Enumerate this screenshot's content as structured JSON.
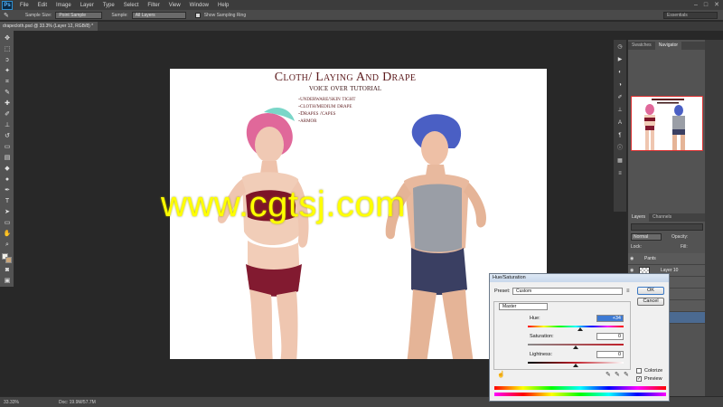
{
  "menubar": {
    "logo": "Ps",
    "items": [
      "File",
      "Edit",
      "Image",
      "Layer",
      "Type",
      "Select",
      "Filter",
      "View",
      "Window",
      "Help"
    ],
    "window_controls": [
      "‒",
      "□",
      "✕"
    ]
  },
  "options": {
    "sample_size_label": "Sample Size:",
    "sample_size_value": "Point Sample",
    "sample_label": "Sample:",
    "sample_value": "All Layers",
    "show_ring_label": "Show Sampling Ring",
    "workspace": "Essentials"
  },
  "document": {
    "tab_title": "drapecloth.psd @ 33.3% (Layer 12, RGB/8) *"
  },
  "artwork": {
    "title": "Cloth/ Laying And Drape",
    "subtitle": "voice over tutorial",
    "bullets": [
      "-underware/skin tight",
      "-cloth/medium drape",
      "-Drapes /capes",
      "-armor"
    ],
    "watermark": "www.cgtsj.com"
  },
  "panels": {
    "top_tabs": [
      "Swatches",
      "Navigator"
    ],
    "layer_tabs": [
      "Layers",
      "Channels"
    ],
    "blend_mode": "Normal",
    "opacity_label": "Opacity:",
    "fill_label": "Fill:",
    "lock_label": "Lock:",
    "layers": [
      "Pants",
      "Layer 10"
    ]
  },
  "status": {
    "zoom": "33.33%",
    "doc": "Doc: 19.9M/57.7M"
  },
  "hue_sat": {
    "title": "Hue/Saturation",
    "preset_label": "Preset:",
    "preset_value": "Custom",
    "channel": "Master",
    "hue_label": "Hue:",
    "hue_value": "+34",
    "hue_level": 0.55,
    "saturation_label": "Saturation:",
    "saturation_value": "0",
    "saturation_level": 0.5,
    "lightness_label": "Lightness:",
    "lightness_value": "0",
    "lightness_level": 0.5,
    "ok": "OK",
    "cancel": "Cancel",
    "colorize": "Colorize",
    "preview": "Preview",
    "preview_checked": "✓"
  }
}
